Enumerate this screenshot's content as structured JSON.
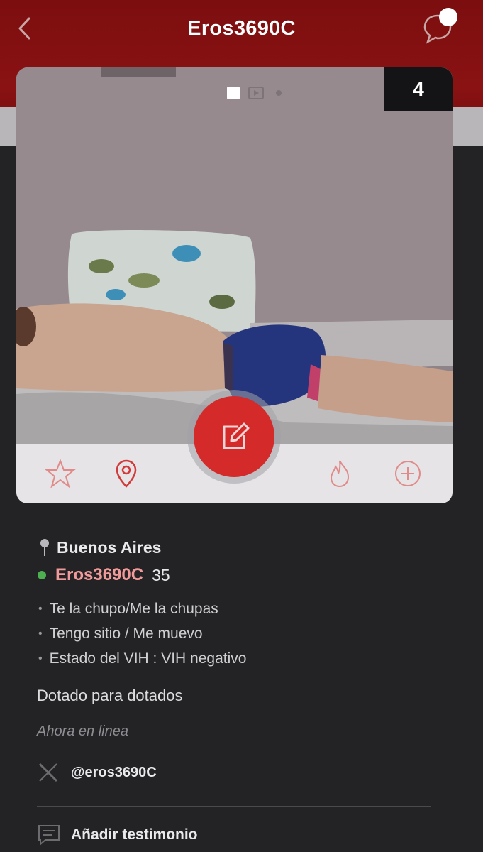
{
  "header": {
    "title": "Eros3690C",
    "back_icon": "chevron-left-icon",
    "chat_icon": "chat-bubble-icon"
  },
  "photo": {
    "count": "4",
    "indicator_icons": [
      "square-dot-icon",
      "video-dot-icon",
      "small-dot-icon"
    ]
  },
  "actions": {
    "favorite_icon": "star-icon",
    "location_icon": "map-pin-icon",
    "edit_icon": "edit-icon",
    "flame_icon": "flame-icon",
    "add_icon": "plus-circle-icon"
  },
  "profile": {
    "city": "Buenos Aires",
    "username": "Eros3690C",
    "age": "35",
    "tags": [
      "Te la chupo/Me la chupas",
      "Tengo sitio / Me muevo",
      "Estado del VIH : VIH negativo"
    ],
    "bio": "Dotado para dotados",
    "status": "Ahora en linea",
    "social_handle": "@eros3690C"
  },
  "testimonial": {
    "label": "Añadir testimonio"
  },
  "colors": {
    "header_red": "#8a1213",
    "accent_red": "#d42a2a",
    "username_pink": "#f29a9a",
    "online_green": "#4caf50",
    "background": "#232326"
  }
}
